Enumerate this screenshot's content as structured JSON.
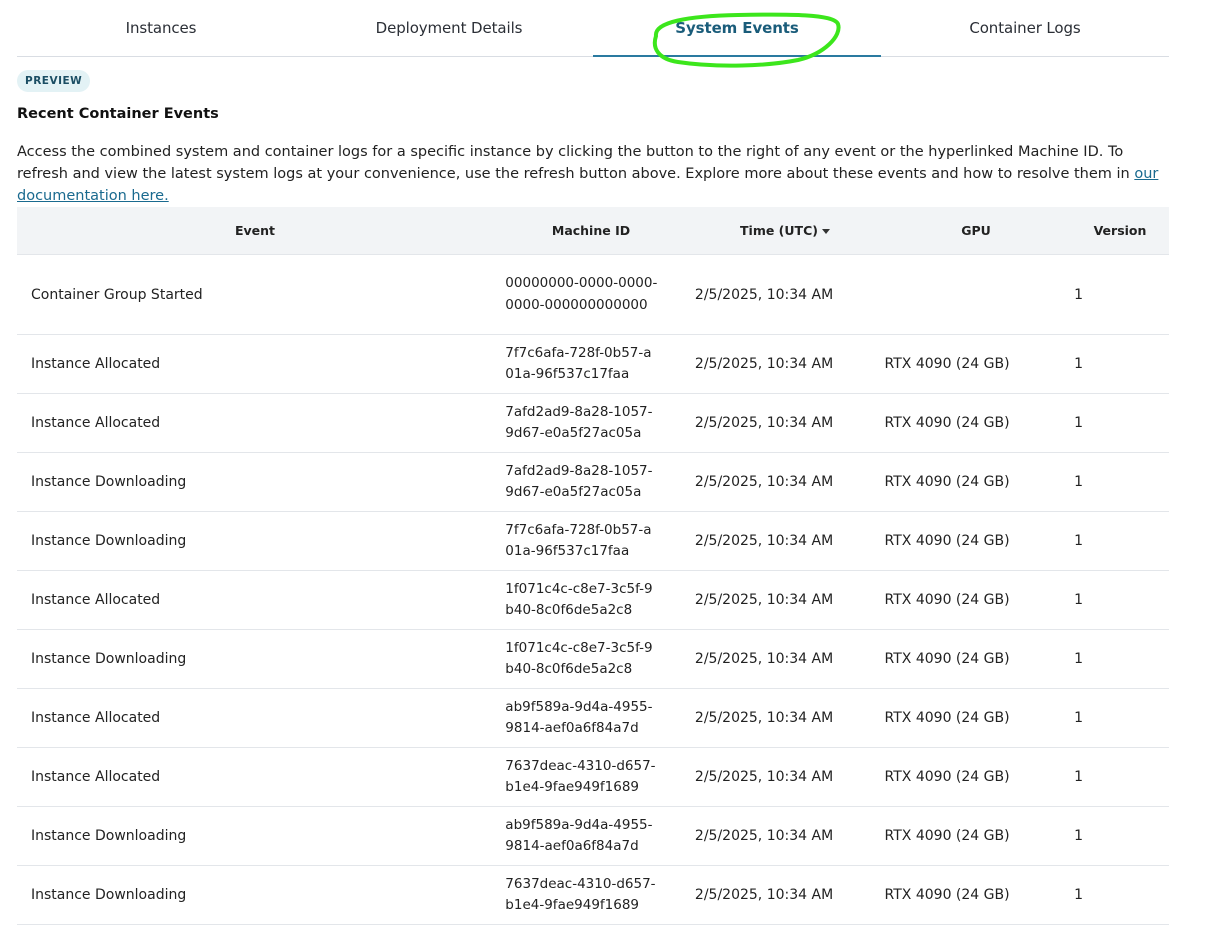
{
  "tabs": [
    {
      "label": "Instances",
      "active": false
    },
    {
      "label": "Deployment Details",
      "active": false
    },
    {
      "label": "System Events",
      "active": true
    },
    {
      "label": "Container Logs",
      "active": false
    }
  ],
  "badge": "PREVIEW",
  "section_title": "Recent Container Events",
  "description": {
    "text": "Access the combined system and container logs for a specific instance by clicking the button to the right of any event or the hyperlinked Machine ID. To refresh and view the latest system logs at your convenience, use the refresh button above. Explore more about these events and how to resolve them in ",
    "link": "our documentation here."
  },
  "table": {
    "headers": {
      "event": "Event",
      "machine_id": "Machine ID",
      "time": "Time (UTC)",
      "gpu": "GPU",
      "version": "Version"
    },
    "rows": [
      {
        "event": "Container Group Started",
        "machine_id": "00000000-0000-0000-0000-000000000000",
        "time": "2/5/2025, 10:34 AM",
        "gpu": "",
        "version": "1"
      },
      {
        "event": "Instance Allocated",
        "machine_id": "7f7c6afa-728f-0b57-a01a-96f537c17faa",
        "time": "2/5/2025, 10:34 AM",
        "gpu": "RTX 4090 (24 GB)",
        "version": "1"
      },
      {
        "event": "Instance Allocated",
        "machine_id": "7afd2ad9-8a28-1057-9d67-e0a5f27ac05a",
        "time": "2/5/2025, 10:34 AM",
        "gpu": "RTX 4090 (24 GB)",
        "version": "1"
      },
      {
        "event": "Instance Downloading",
        "machine_id": "7afd2ad9-8a28-1057-9d67-e0a5f27ac05a",
        "time": "2/5/2025, 10:34 AM",
        "gpu": "RTX 4090 (24 GB)",
        "version": "1"
      },
      {
        "event": "Instance Downloading",
        "machine_id": "7f7c6afa-728f-0b57-a01a-96f537c17faa",
        "time": "2/5/2025, 10:34 AM",
        "gpu": "RTX 4090 (24 GB)",
        "version": "1"
      },
      {
        "event": "Instance Allocated",
        "machine_id": "1f071c4c-c8e7-3c5f-9b40-8c0f6de5a2c8",
        "time": "2/5/2025, 10:34 AM",
        "gpu": "RTX 4090 (24 GB)",
        "version": "1"
      },
      {
        "event": "Instance Downloading",
        "machine_id": "1f071c4c-c8e7-3c5f-9b40-8c0f6de5a2c8",
        "time": "2/5/2025, 10:34 AM",
        "gpu": "RTX 4090 (24 GB)",
        "version": "1"
      },
      {
        "event": "Instance Allocated",
        "machine_id": "ab9f589a-9d4a-4955-9814-aef0a6f84a7d",
        "time": "2/5/2025, 10:34 AM",
        "gpu": "RTX 4090 (24 GB)",
        "version": "1"
      },
      {
        "event": "Instance Allocated",
        "machine_id": "7637deac-4310-d657-b1e4-9fae949f1689",
        "time": "2/5/2025, 10:34 AM",
        "gpu": "RTX 4090 (24 GB)",
        "version": "1"
      },
      {
        "event": "Instance Downloading",
        "machine_id": "ab9f589a-9d4a-4955-9814-aef0a6f84a7d",
        "time": "2/5/2025, 10:34 AM",
        "gpu": "RTX 4090 (24 GB)",
        "version": "1"
      },
      {
        "event": "Instance Downloading",
        "machine_id": "7637deac-4310-d657-b1e4-9fae949f1689",
        "time": "2/5/2025, 10:34 AM",
        "gpu": "RTX 4090 (24 GB)",
        "version": "1"
      }
    ]
  },
  "colors": {
    "active_tab": "#1a5c7a",
    "annotation": "#3ce61c",
    "link": "#1a6a8f"
  },
  "icons": {
    "sort": "caret-down-icon"
  }
}
